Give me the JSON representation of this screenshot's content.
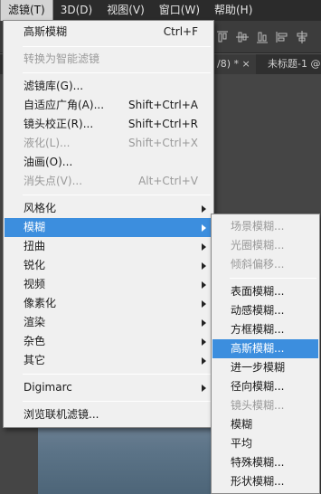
{
  "menubar": {
    "items": [
      "滤镜(T)",
      "3D(D)",
      "视图(V)",
      "窗口(W)",
      "帮助(H)"
    ]
  },
  "document_tabs": [
    "/8) * ×",
    "未标题-1 @"
  ],
  "filter_menu": {
    "items": [
      {
        "label": "高斯模糊",
        "shortcut": "Ctrl+F",
        "enabled": true
      },
      {
        "label": "转换为智能滤镜",
        "enabled": false
      },
      {
        "label": "滤镜库(G)...",
        "enabled": true
      },
      {
        "label": "自适应广角(A)...",
        "shortcut": "Shift+Ctrl+A",
        "enabled": true
      },
      {
        "label": "镜头校正(R)...",
        "shortcut": "Shift+Ctrl+R",
        "enabled": true
      },
      {
        "label": "液化(L)...",
        "shortcut": "Shift+Ctrl+X",
        "enabled": false
      },
      {
        "label": "油画(O)...",
        "enabled": true
      },
      {
        "label": "消失点(V)...",
        "shortcut": "Alt+Ctrl+V",
        "enabled": false
      },
      {
        "label": "风格化",
        "submenu": true
      },
      {
        "label": "模糊",
        "submenu": true,
        "highlighted": true
      },
      {
        "label": "扭曲",
        "submenu": true
      },
      {
        "label": "锐化",
        "submenu": true
      },
      {
        "label": "视频",
        "submenu": true
      },
      {
        "label": "像素化",
        "submenu": true
      },
      {
        "label": "渲染",
        "submenu": true
      },
      {
        "label": "杂色",
        "submenu": true
      },
      {
        "label": "其它",
        "submenu": true
      },
      {
        "label": "Digimarc",
        "submenu": true
      },
      {
        "label": "浏览联机滤镜...",
        "enabled": true
      }
    ]
  },
  "blur_submenu": {
    "items": [
      {
        "label": "场景模糊...",
        "enabled": false
      },
      {
        "label": "光圈模糊...",
        "enabled": false
      },
      {
        "label": "倾斜偏移...",
        "enabled": false
      },
      {
        "label": "表面模糊...",
        "enabled": true
      },
      {
        "label": "动感模糊...",
        "enabled": true
      },
      {
        "label": "方框模糊...",
        "enabled": true
      },
      {
        "label": "高斯模糊...",
        "enabled": true,
        "highlighted": true
      },
      {
        "label": "进一步模糊",
        "enabled": true
      },
      {
        "label": "径向模糊...",
        "enabled": true
      },
      {
        "label": "镜头模糊...",
        "enabled": false
      },
      {
        "label": "模糊",
        "enabled": true
      },
      {
        "label": "平均",
        "enabled": true
      },
      {
        "label": "特殊模糊...",
        "enabled": true
      },
      {
        "label": "形状模糊...",
        "enabled": true
      }
    ]
  },
  "colors": {
    "highlight": "#3c8ede",
    "menu_bg": "#f0f0f0",
    "disabled_text": "#9a9a9a",
    "menubar_bg": "#2b2b2b"
  }
}
